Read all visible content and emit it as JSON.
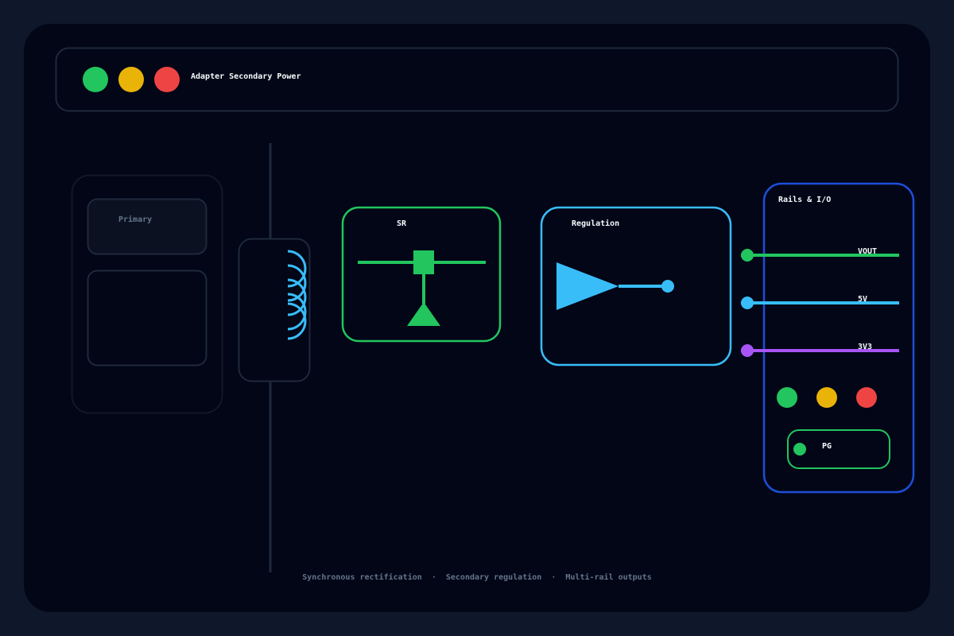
{
  "window": {
    "title": "Adapter Secondary Power",
    "traffic_lights": [
      {
        "name": "green",
        "color": "#22c55e"
      },
      {
        "name": "yellow",
        "color": "#eab308"
      },
      {
        "name": "red",
        "color": "#ef4444"
      }
    ]
  },
  "colors": {
    "page_bg": "#0f172a",
    "panel_bg": "#020617",
    "border_muted": "#1e293b",
    "sr_green": "#22c55e",
    "reg_blue": "#38bdf8",
    "rails_border": "#1d4ed8",
    "rail_3v3": "#a855f7",
    "text_main": "#f8fafc",
    "text_muted": "#64748b"
  },
  "primary": {
    "label": "Primary"
  },
  "transformer": {
    "icon": "transformer-coil-icon"
  },
  "sr": {
    "label": "SR",
    "icon": "mosfet-diode-icon"
  },
  "regulation": {
    "label": "Regulation",
    "icon": "amplifier-icon"
  },
  "rails": {
    "title": "Rails & I/O",
    "items": [
      {
        "label": "VOUT",
        "color": "#22c55e"
      },
      {
        "label": "5V",
        "color": "#38bdf8"
      },
      {
        "label": "3V3",
        "color": "#a855f7"
      }
    ],
    "status_leds": [
      {
        "name": "green",
        "color": "#22c55e"
      },
      {
        "name": "yellow",
        "color": "#eab308"
      },
      {
        "name": "red",
        "color": "#ef4444"
      }
    ],
    "pg": {
      "label": "PG",
      "color": "#22c55e"
    }
  },
  "footer": {
    "caption": "Synchronous rectification  ·  Secondary regulation  ·  Multi-rail outputs"
  }
}
